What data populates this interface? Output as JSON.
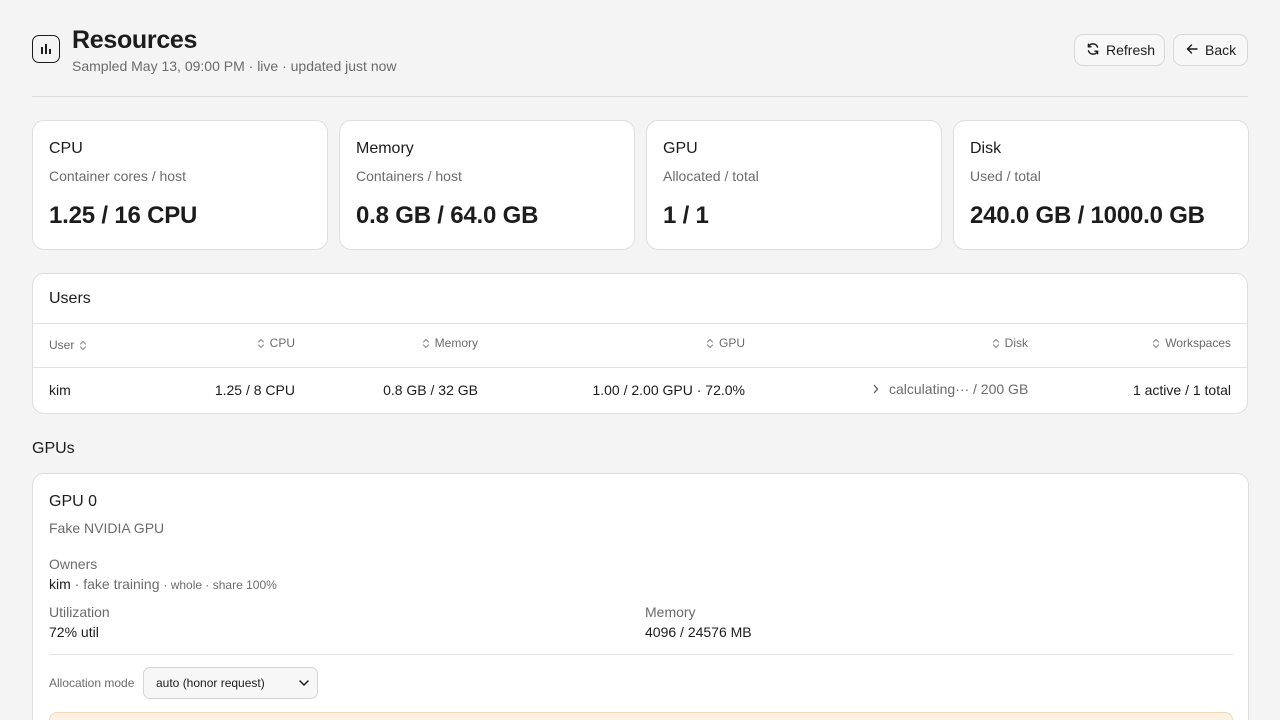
{
  "header": {
    "title": "Resources",
    "subtitle": "Sampled May 13, 09:00 PM · live · updated just now",
    "refresh_label": "Refresh",
    "back_label": "Back"
  },
  "cards": [
    {
      "title": "CPU",
      "subtitle": "Container cores / host",
      "value": "1.25 / 16 CPU"
    },
    {
      "title": "Memory",
      "subtitle": "Containers / host",
      "value": "0.8 GB / 64.0 GB"
    },
    {
      "title": "GPU",
      "subtitle": "Allocated / total",
      "value": "1 / 1"
    },
    {
      "title": "Disk",
      "subtitle": "Used / total",
      "value": "240.0 GB / 1000.0 GB"
    }
  ],
  "users": {
    "title": "Users",
    "columns": [
      "User",
      "CPU",
      "Memory",
      "GPU",
      "Disk",
      "Workspaces"
    ],
    "rows": [
      {
        "user": "kim",
        "cpu": "1.25 / 8 CPU",
        "memory": "0.8 GB / 32 GB",
        "gpu": "1.00 / 2.00 GPU · 72.0%",
        "disk": "calculating··· / 200 GB",
        "workspaces": "1 active / 1 total"
      }
    ]
  },
  "gpus": {
    "section_title": "GPUs",
    "items": [
      {
        "name": "GPU 0",
        "model": "Fake NVIDIA GPU",
        "owners_label": "Owners",
        "owner_user": "kim",
        "owner_workspace": "· fake training",
        "owner_detail": "· whole · share 100%",
        "utilization_label": "Utilization",
        "utilization_value": "72% util",
        "memory_label": "Memory",
        "memory_value": "4096 / 24576 MB",
        "allocation_label": "Allocation mode",
        "allocation_value": "auto (honor request)"
      }
    ]
  },
  "colors": {
    "background": "#f4f4f4",
    "card": "#ffffff",
    "warning_bg": "#fdf1e3",
    "muted_text": "#6b6b6b"
  },
  "icons": {
    "app": "bar-chart-icon",
    "refresh": "refresh-icon",
    "back": "arrow-left-icon",
    "sort": "sort-icon",
    "expand": "chevron-right-icon",
    "select": "chevron-down-icon"
  }
}
